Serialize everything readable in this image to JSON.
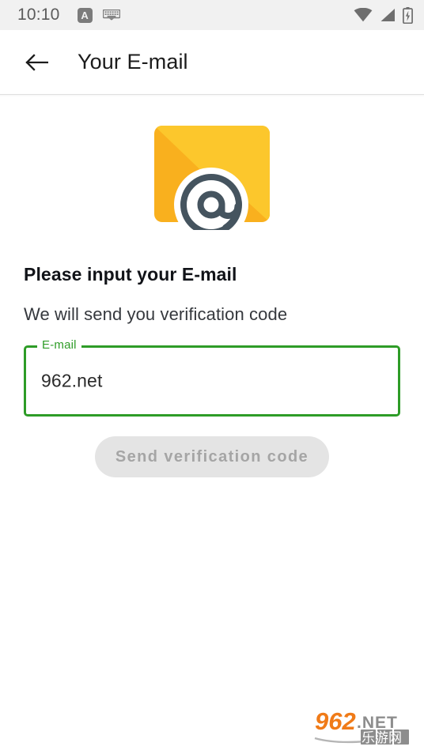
{
  "status_bar": {
    "clock": "10:10",
    "ime_badge_label": "A",
    "icons": [
      "keyboard-icon",
      "wifi-icon",
      "cellular-signal-icon",
      "battery-charging-icon"
    ]
  },
  "app_bar": {
    "back_icon": "arrow-left-icon",
    "title": "Your E-mail"
  },
  "hero": {
    "icon": "email-envelope-at-icon",
    "envelope_flap_color": "#fcc72c",
    "envelope_body_color": "#f9b01e",
    "at_symbol_color": "#45545f"
  },
  "main": {
    "headline": "Please input your E-mail",
    "subline": "We will send you verification code",
    "field": {
      "label": "E-mail",
      "value": "962.net",
      "placeholder": "E-mail",
      "accent_color": "#2e9c27"
    },
    "button": {
      "label": "Send verification code",
      "enabled": false,
      "background": "#e4e4e4",
      "text_color": "#a5a5a5"
    }
  },
  "watermark": {
    "number": "962",
    "suffix": ".NET",
    "chinese": "乐游网",
    "number_color": "#f07b18",
    "suffix_color": "#8d8d8d"
  }
}
